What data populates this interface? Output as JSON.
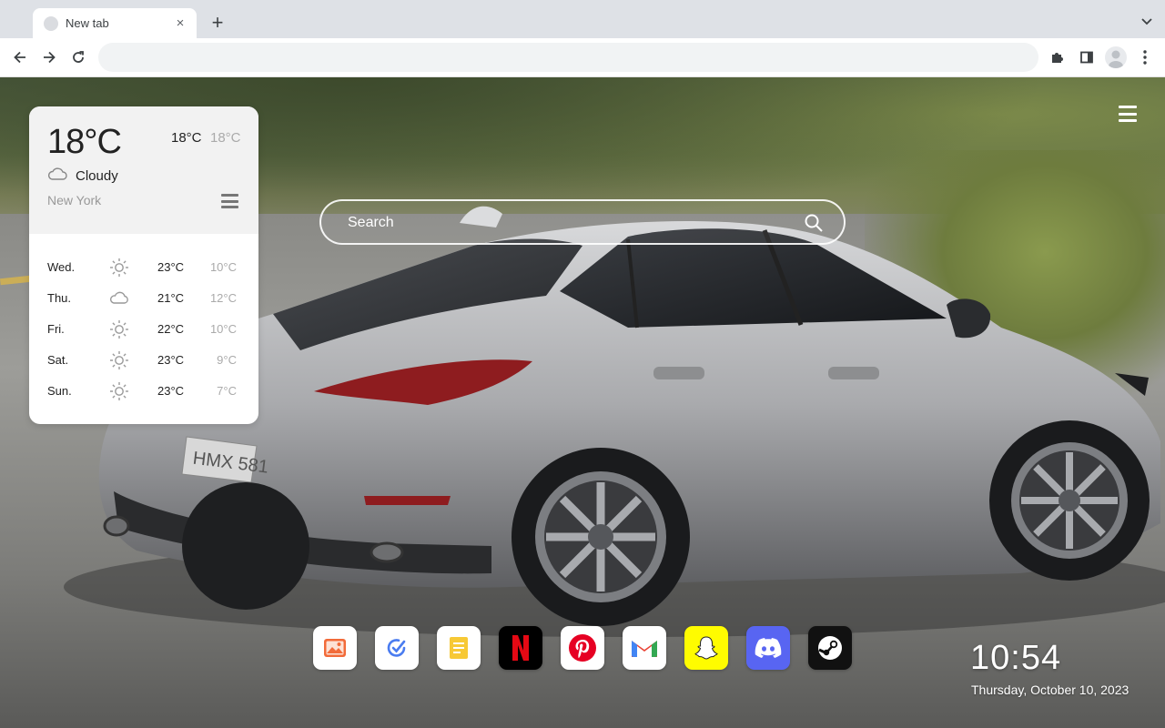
{
  "browser": {
    "tab": {
      "title": "New tab",
      "close_glyph": "×"
    },
    "new_tab_glyph": "+",
    "omnibox": {
      "value": "",
      "placeholder": ""
    }
  },
  "weather": {
    "temperature": "18°C",
    "high": "18°C",
    "low": "18°C",
    "condition": "Cloudy",
    "condition_icon": "cloud-icon",
    "city": "New York",
    "forecast": [
      {
        "day": "Wed.",
        "icon": "sun-icon",
        "high": "23°C",
        "low": "10°C"
      },
      {
        "day": "Thu.",
        "icon": "cloud-icon",
        "high": "21°C",
        "low": "12°C"
      },
      {
        "day": "Fri.",
        "icon": "sun-icon",
        "high": "22°C",
        "low": "10°C"
      },
      {
        "day": "Sat.",
        "icon": "sun-icon",
        "high": "23°C",
        "low": "9°C"
      },
      {
        "day": "Sun.",
        "icon": "sun-icon",
        "high": "23°C",
        "low": "7°C"
      }
    ]
  },
  "search": {
    "placeholder": "Search"
  },
  "dock": {
    "apps": [
      {
        "name": "gallery",
        "icon": "image-icon",
        "color": "#ffffff"
      },
      {
        "name": "tasks",
        "icon": "check-icon",
        "color": "#ffffff"
      },
      {
        "name": "notes",
        "icon": "note-icon",
        "color": "#ffffff"
      },
      {
        "name": "netflix",
        "icon": "netflix-icon",
        "color": "#000000"
      },
      {
        "name": "pinterest",
        "icon": "pinterest-icon",
        "color": "#ffffff"
      },
      {
        "name": "gmail",
        "icon": "gmail-icon",
        "color": "#ffffff"
      },
      {
        "name": "snapchat",
        "icon": "snapchat-icon",
        "color": "#fffc00"
      },
      {
        "name": "discord",
        "icon": "discord-icon",
        "color": "#5865f2"
      },
      {
        "name": "steam",
        "icon": "steam-icon",
        "color": "#111111"
      }
    ]
  },
  "clock": {
    "time": "10:54",
    "date": "Thursday, October 10, 2023"
  }
}
